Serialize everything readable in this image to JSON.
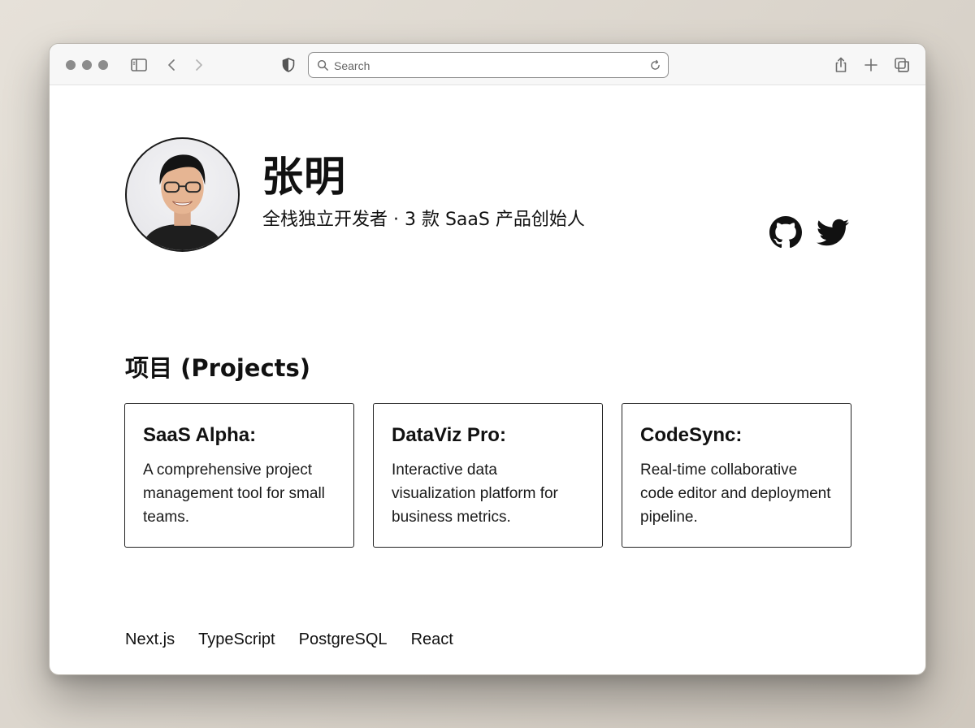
{
  "browser": {
    "search_placeholder": "Search"
  },
  "icons": {
    "sidebar": "sidebar-icon",
    "back": "chevron-left-icon",
    "forward": "chevron-right-icon",
    "shield": "shield-icon",
    "search": "search-icon",
    "reload": "reload-icon",
    "share": "share-icon",
    "new_tab": "plus-icon",
    "tabs": "tabs-overview-icon",
    "github": "github-icon",
    "twitter": "twitter-icon"
  },
  "profile": {
    "name": "张明",
    "tagline": "全栈独立开发者 · 3 款 SaaS 产品创始人"
  },
  "projects": {
    "heading": "项目 (Projects)",
    "items": [
      {
        "title": "SaaS Alpha:",
        "description": "A comprehensive project management tool for small teams."
      },
      {
        "title": "DataViz Pro:",
        "description": "Interactive data visualization platform for business metrics."
      },
      {
        "title": "CodeSync:",
        "description": "Real-time collaborative code editor and deployment pipeline."
      }
    ]
  },
  "tech_stack": [
    "Next.js",
    "TypeScript",
    "PostgreSQL",
    "React"
  ],
  "colors": {
    "traffic_light": "#8c8c8c",
    "text": "#111111",
    "border": "#222222"
  }
}
